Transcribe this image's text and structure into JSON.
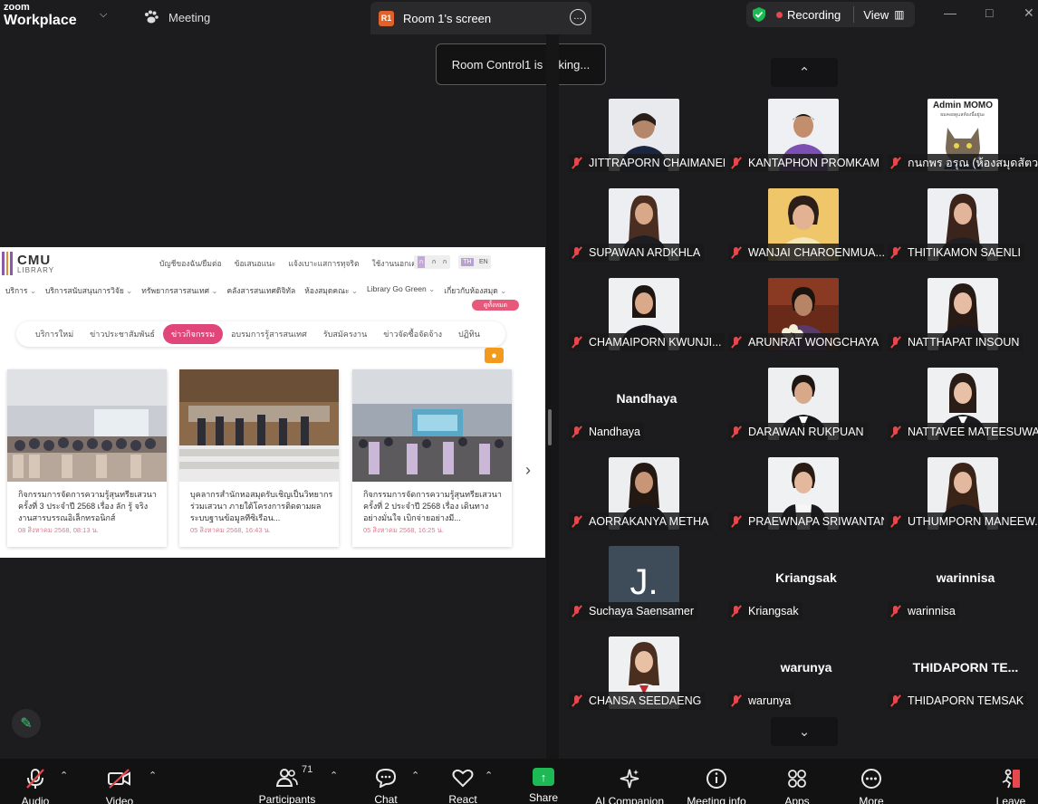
{
  "titlebar": {
    "brand_top": "zoom",
    "brand_bottom": "Workplace",
    "meeting_tab": "Meeting",
    "screen_tab_badge": "R1",
    "screen_tab_label": "Room 1's screen",
    "recording_label": "Recording",
    "view_label": "View"
  },
  "toast": "Room Control1 is talking...",
  "shared_screen": {
    "logo_top": "CMU",
    "logo_bottom": "LIBRARY",
    "top_links": [
      "บัญชีของฉัน/ยืมต่อ",
      "ข้อเสนอแนะ",
      "แจ้งเบาะแสการทุจริต",
      "ใช้งานนอกเครือข่าย"
    ],
    "lang_a": [
      "ก",
      "ก",
      "ก"
    ],
    "lang_b": [
      "TH",
      "EN"
    ],
    "nav": [
      "บริการ",
      "บริการสนับสนุนการวิจัย",
      "ทรัพยากรสารสนเทศ",
      "คลังสารสนเทศดิจิทัล",
      "ห้องสมุดคณะ",
      "Library Go Green",
      "เกี่ยวกับห้องสมุด"
    ],
    "subscribe_tag": "ดูทั้งหมด",
    "categories": [
      "บริการใหม่",
      "ข่าวประชาสัมพันธ์",
      "ข่าวกิจกรรม",
      "อบรมการรู้สารสนเทศ",
      "รับสมัครงาน",
      "ข่าวจัดซื้อจัดจ้าง",
      "ปฏิทิน"
    ],
    "active_category": "ข่าวกิจกรรม",
    "cards": [
      {
        "title": "กิจกรรมการจัดการความรู้สุนทรียเสวนา ครั้งที่ 3 ประจำปี 2568 เรื่อง ลัก รู้ จริง งานสารบรรณอิเล็กทรอนิกส์",
        "date": "08 สิงหาคม 2568, 08:13 น."
      },
      {
        "title": "บุคลากรสำนักหอสมุดรับเชิญเป็นวิทยากรร่วมเสวนา ภายใต้โครงการติดตามผลระบบฐานข้อมูลทีซิเรือน...",
        "date": "05 สิงหาคม 2568, 16:43 น."
      },
      {
        "title": "กิจกรรมการจัดการความรู้สุนทรียเสวนา ครั้งที่ 2 ประจำปี 2568 เรื่อง เดินทางอย่างมั่นใจ เบิกจ่ายอย่างมี...",
        "date": "05 สิงหาคม 2568, 16:25 น."
      }
    ]
  },
  "participants": [
    {
      "name": "JITTRAPORN CHAIMANEE",
      "kind": "photo"
    },
    {
      "name": "KANTAPHON PROMKAM",
      "kind": "photo"
    },
    {
      "name": "กนกพร  อรุณ (ห้องสมุดสัตว...",
      "kind": "photo"
    },
    {
      "name": "SUPAWAN ARDKHLA",
      "kind": "photo"
    },
    {
      "name": "WANJAI CHAROENMUA...",
      "kind": "photo"
    },
    {
      "name": "THITIKAMON SAENLI",
      "kind": "photo"
    },
    {
      "name": "CHAMAIPORN KWUNJI...",
      "kind": "photo"
    },
    {
      "name": "ARUNRAT WONGCHAYA",
      "kind": "photo"
    },
    {
      "name": "NATTHAPAT INSOUN",
      "kind": "photo"
    },
    {
      "name": "Nandhaya",
      "kind": "text",
      "display": "Nandhaya"
    },
    {
      "name": "DARAWAN RUKPUAN",
      "kind": "photo"
    },
    {
      "name": "NATTAVEE MATEESUWAPAP",
      "kind": "photo"
    },
    {
      "name": "AORRAKANYA METHA",
      "kind": "photo"
    },
    {
      "name": "PRAEWNAPA SRIWANTAN",
      "kind": "photo"
    },
    {
      "name": "UTHUMPORN MANEEW...",
      "kind": "photo"
    },
    {
      "name": "Suchaya Saensamer",
      "kind": "initial",
      "display": "J."
    },
    {
      "name": "Kriangsak",
      "kind": "text",
      "display": "Kriangsak"
    },
    {
      "name": "warinnisa",
      "kind": "text",
      "display": "warinnisa"
    },
    {
      "name": "CHANSA SEEDAENG",
      "kind": "photo"
    },
    {
      "name": "warunya",
      "kind": "text",
      "display": "warunya"
    },
    {
      "name": "THIDAPORN TEMSAK",
      "kind": "text",
      "display": "THIDAPORN  TE..."
    }
  ],
  "admin_card": {
    "line1": "Admin MOMO",
    "line2": "ผมคอยดูแลห้องนี้อยู่นะ"
  },
  "toolbar": {
    "audio": "Audio",
    "video": "Video",
    "participants": "Participants",
    "participant_count": "71",
    "chat": "Chat",
    "react": "React",
    "share": "Share",
    "ai": "AI Companion",
    "info": "Meeting info",
    "apps": "Apps",
    "more": "More",
    "leave": "Leave"
  },
  "colors": {
    "accent_pink": "#e0467a",
    "record_red": "#e5484d",
    "share_green": "#1db954",
    "muted_red": "#e5484d"
  }
}
